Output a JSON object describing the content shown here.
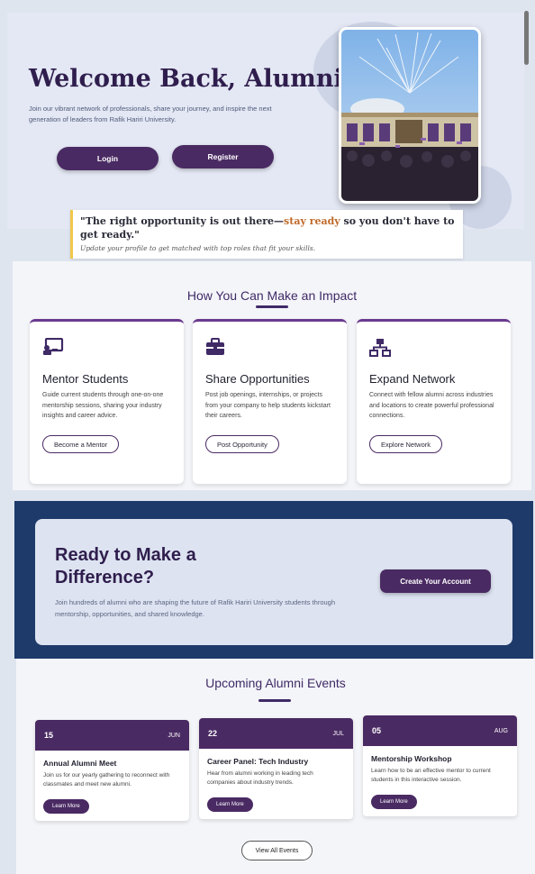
{
  "hero": {
    "title": "Welcome Back, Alumni!",
    "subtitle": "Join our vibrant network of professionals, share your journey, and inspire the next generation of leaders from Rafik Hariri University.",
    "login_label": "Login",
    "register_label": "Register"
  },
  "quote": {
    "text_before": "\"The right opportunity is out there—",
    "highlight": "stay ready",
    "text_after": " so you don't have to get ready.\"",
    "subtext": "Update your profile to get matched with top roles that fit your skills."
  },
  "impact": {
    "title": "How You Can Make an Impact",
    "cards": [
      {
        "icon": "teacher-board-icon",
        "title": "Mentor Students",
        "text": "Guide current students through one-on-one mentorship sessions, sharing your industry insights and career advice.",
        "button": "Become a Mentor"
      },
      {
        "icon": "briefcase-icon",
        "title": "Share Opportunities",
        "text": "Post job openings, internships, or projects from your company to help students kickstart their careers.",
        "button": "Post Opportunity"
      },
      {
        "icon": "network-icon",
        "title": "Expand Network",
        "text": "Connect with fellow alumni across industries and locations to create powerful professional connections.",
        "button": "Explore Network"
      }
    ]
  },
  "cta": {
    "title_line1": "Ready to Make a",
    "title_line2": "Difference?",
    "text": "Join hundreds of alumni who are shaping the future of Rafik Hariri University students through mentorship, opportunities, and shared knowledge.",
    "button": "Create Your Account"
  },
  "events": {
    "title": "Upcoming Alumni Events",
    "items": [
      {
        "day": "15",
        "month": "JUN",
        "title": "Annual Alumni Meet",
        "text": "Join us for our yearly gathering to reconnect with classmates and meet new alumni.",
        "button": "Learn More"
      },
      {
        "day": "22",
        "month": "JUL",
        "title": "Career Panel: Tech Industry",
        "text": "Hear from alumni working in leading tech companies about industry trends.",
        "button": "Learn More"
      },
      {
        "day": "05",
        "month": "AUG",
        "title": "Mentorship Workshop",
        "text": "Learn how to be an effective mentor to current students in this interactive session.",
        "button": "Learn More"
      }
    ],
    "view_all": "View All Events"
  },
  "colors": {
    "brand": "#4a2a63",
    "navy": "#1e3a6a",
    "highlight": "#c06a2a"
  }
}
